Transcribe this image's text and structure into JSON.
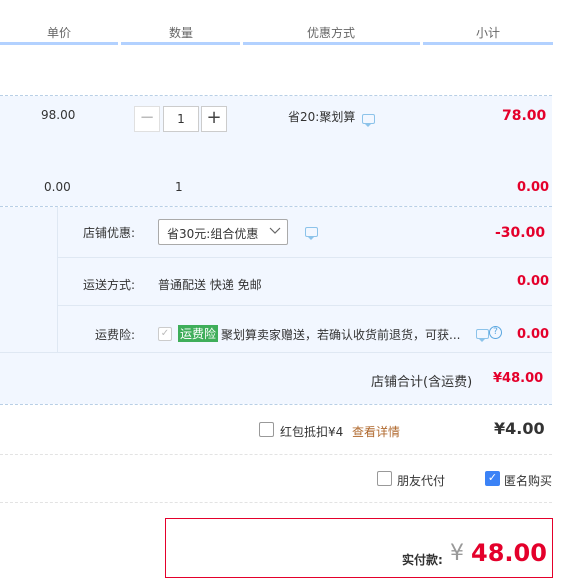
{
  "header": {
    "unit_price": "单价",
    "quantity": "数量",
    "discount_method": "优惠方式",
    "subtotal": "小计"
  },
  "item1": {
    "price": "98.00",
    "quantity": "1",
    "minus": "−",
    "plus": "+",
    "promo": "省20:聚划算",
    "subtotal": "78.00"
  },
  "item2": {
    "price": "0.00",
    "quantity": "1",
    "subtotal": "0.00"
  },
  "shop": {
    "discount_label": "店铺优惠:",
    "discount_select": "省30元:组合优惠",
    "discount_value": "-30.00",
    "shipping_label": "运送方式:",
    "shipping_value": "普通配送 快递 免邮",
    "shipping_amount": "0.00",
    "insurance_label": "运费险:",
    "insurance_tag": "运费险",
    "insurance_desc": "聚划算卖家赠送，若确认收货前退货，可获...",
    "insurance_amount": "0.00",
    "total_label": "店铺合计(含运费)",
    "total_value": "¥48.00"
  },
  "redpacket": {
    "label": "红包抵扣¥4",
    "link": "查看详情",
    "amount": "¥4.00"
  },
  "options": {
    "friend_pay": "朋友代付",
    "anonymous": "匿名购买"
  },
  "payment": {
    "label": "实付款:",
    "currency": "¥",
    "amount": "48.00"
  },
  "colors": {
    "accent_red": "#e4002b",
    "insurance_green": "#3fae5a",
    "header_bar": "#b2d1ff"
  }
}
